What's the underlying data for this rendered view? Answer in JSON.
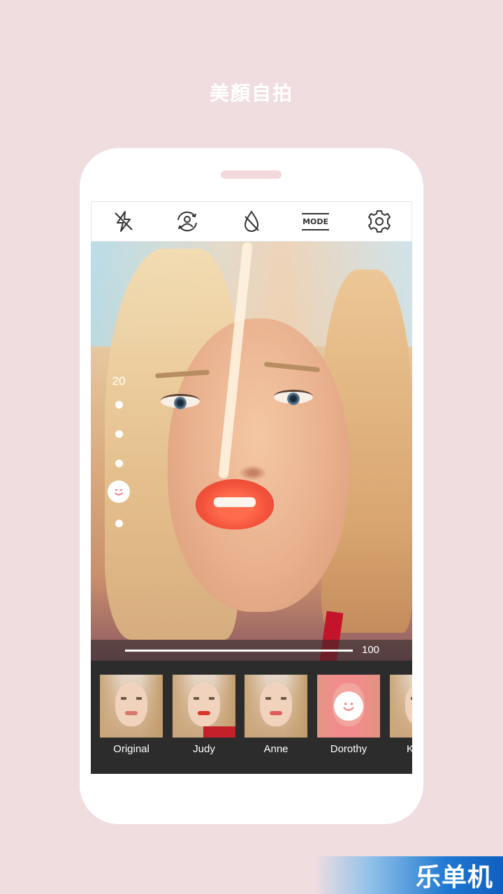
{
  "headline": "美顏自拍",
  "toolbar": {
    "icons": [
      "flash-off-icon",
      "switch-camera-icon",
      "drop-icon",
      "mode-icon",
      "settings-icon"
    ],
    "mode_label": "MODE"
  },
  "beauty_level": {
    "label": "20"
  },
  "slider": {
    "value": "100"
  },
  "filters": [
    {
      "label": "Original"
    },
    {
      "label": "Judy"
    },
    {
      "label": "Anne"
    },
    {
      "label": "Dorothy",
      "selected": true
    },
    {
      "label": "K"
    }
  ],
  "watermark": "乐单机",
  "colors": {
    "background": "#f0dde0",
    "panel": "#2c2c2c",
    "selected_filter": "#f28c8c",
    "watermark_blue": "#1f78d1"
  }
}
